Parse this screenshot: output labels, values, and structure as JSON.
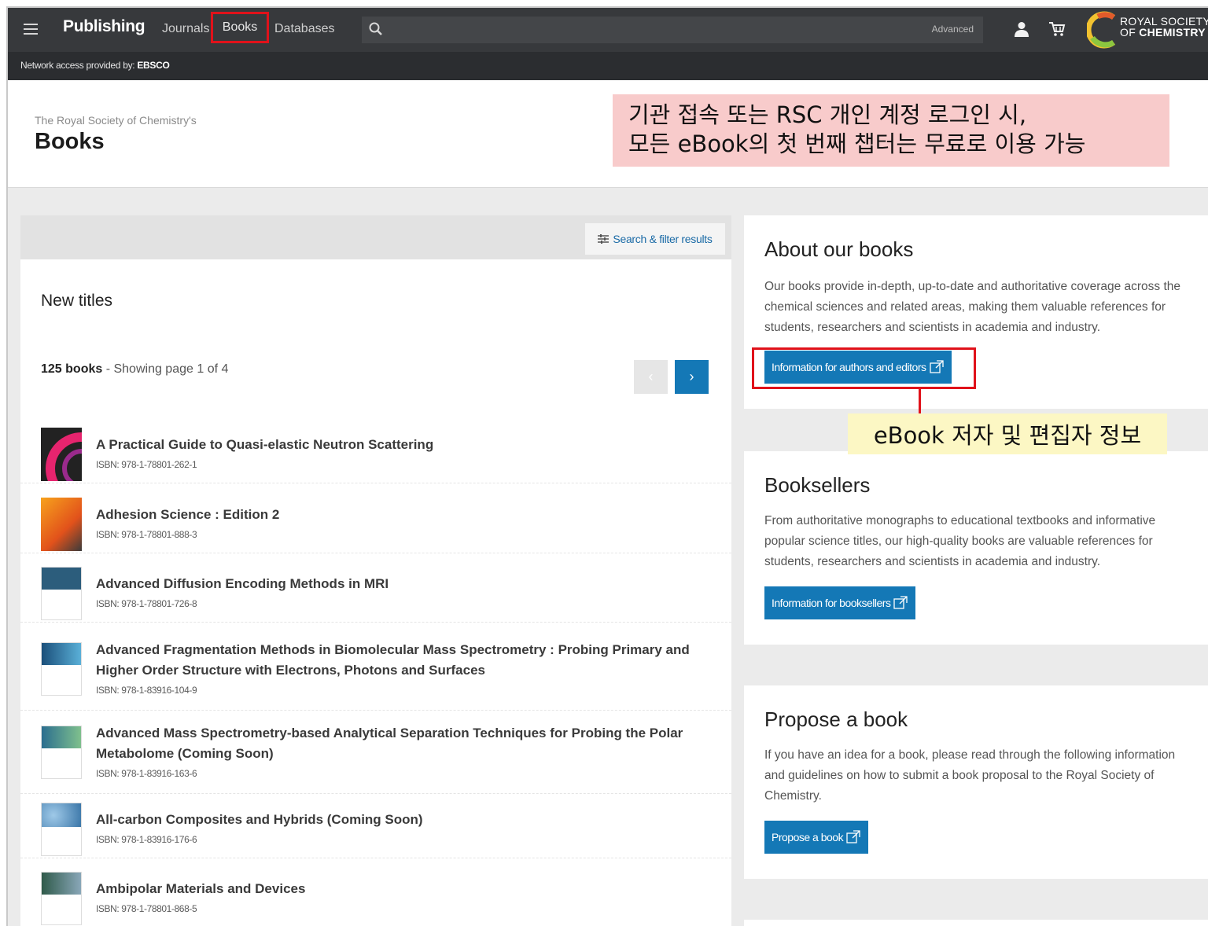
{
  "nav": {
    "brand": "Publishing",
    "links": [
      "Journals",
      "Books",
      "Databases"
    ],
    "search_advanced": "Advanced",
    "logo_line1": "ROYAL SOCIETY",
    "logo_line2_prefix": "OF ",
    "logo_line2_bold": "CHEMISTRY",
    "access_prefix": "Network access provided by: ",
    "access_org": "EBSCO"
  },
  "header": {
    "subtitle": "The Royal Society of Chemistry's",
    "title": "Books"
  },
  "annotations": {
    "top_line1": "기관 접속 또는 RSC 개인 계정 로그인 시,",
    "top_line2": "모든 eBook의 첫 번째 챕터는 무료로 이용 가능",
    "author_info": "eBook 저자 및 편집자 정보"
  },
  "titles_panel": {
    "filter_button": "Search & filter results",
    "heading": "New titles",
    "count_bold": "125 books",
    "count_rest": " - Showing page 1 of 4",
    "prev": "‹",
    "next": "›",
    "books": [
      {
        "title": "A Practical Guide to Quasi-elastic Neutron Scattering",
        "isbn": "ISBN: 978-1-78801-262-1"
      },
      {
        "title": "Adhesion Science : Edition 2",
        "isbn": "ISBN: 978-1-78801-888-3"
      },
      {
        "title": "Advanced Diffusion Encoding Methods in MRI",
        "isbn": "ISBN: 978-1-78801-726-8"
      },
      {
        "title": "Advanced Fragmentation Methods in Biomolecular Mass Spectrometry : Probing Primary and Higher Order Structure with Electrons, Photons and Surfaces",
        "isbn": "ISBN: 978-1-83916-104-9"
      },
      {
        "title": "Advanced Mass Spectrometry-based Analytical Separation Techniques for Probing the Polar Metabolome (Coming Soon)",
        "isbn": "ISBN: 978-1-83916-163-6"
      },
      {
        "title": "All-carbon Composites and Hybrids (Coming Soon)",
        "isbn": "ISBN: 978-1-83916-176-6"
      },
      {
        "title": "Ambipolar Materials and Devices",
        "isbn": "ISBN: 978-1-78801-868-5"
      }
    ]
  },
  "sidebar": {
    "about": {
      "heading": "About our books",
      "text": "Our books provide in-depth, up-to-date and authoritative coverage across the chemical sciences and related areas, making them valuable references for students, researchers and scientists in academia and industry.",
      "button": "Information for authors and editors"
    },
    "booksellers": {
      "heading": "Booksellers",
      "text": "From authoritative monographs to educational textbooks and informative popular science titles, our high-quality books are valuable references for students, researchers and scientists in academia and industry.",
      "button": "Information for booksellers"
    },
    "propose": {
      "heading": "Propose a book",
      "text": "If you have an idea for a book, please read through the following information and guidelines on how to submit a book proposal to the Royal Society of Chemistry.",
      "button": "Propose a book"
    }
  }
}
